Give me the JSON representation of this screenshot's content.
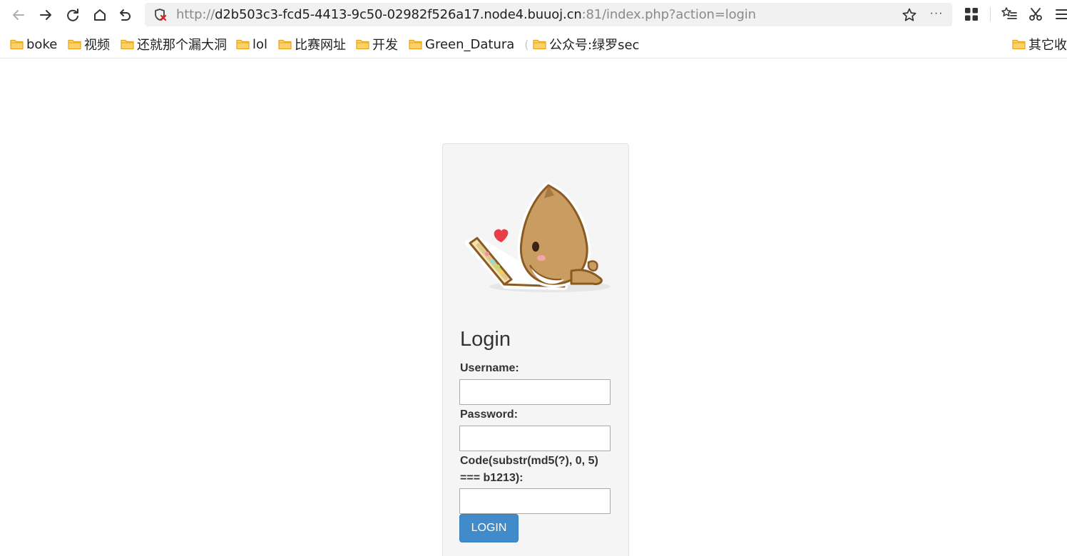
{
  "browser": {
    "url": {
      "scheme": "http://",
      "host": "d2b503c3-fcd5-4413-9c50-02982f526a17.node4.buuoj.cn",
      "rest": ":81/index.php?action=login"
    },
    "more_label": "···",
    "icons": {
      "back": "arrow-left-icon",
      "forward": "arrow-right-icon",
      "reload": "reload-icon",
      "home": "home-icon",
      "undo": "undo-icon",
      "security": "insecure-shield-icon",
      "bookmark": "star-icon",
      "extensions": "grid-icon",
      "favorites": "favorites-list-icon",
      "cut": "scissors-icon",
      "menu": "hamburger-menu-icon"
    }
  },
  "bookmarks": {
    "items": [
      {
        "label": "boke"
      },
      {
        "label": "视频"
      },
      {
        "label": "还就那个漏大洞"
      },
      {
        "label": "lol"
      },
      {
        "label": "比赛网址"
      },
      {
        "label": "开发"
      },
      {
        "label": "Green_Datura"
      },
      {
        "label": "公众号:绿罗sec"
      }
    ],
    "faded_text": "(",
    "other": "其它收"
  },
  "login": {
    "title": "Login",
    "username_label": "Username:",
    "password_label": "Password:",
    "code_label": "Code(substr(md5(?), 0, 5) === b1213):",
    "button_label": "LOGIN",
    "username_value": "",
    "password_value": "",
    "code_value": ""
  },
  "colors": {
    "button": "#428bca",
    "card_bg": "#f5f5f5",
    "folder": "#f4b731"
  }
}
